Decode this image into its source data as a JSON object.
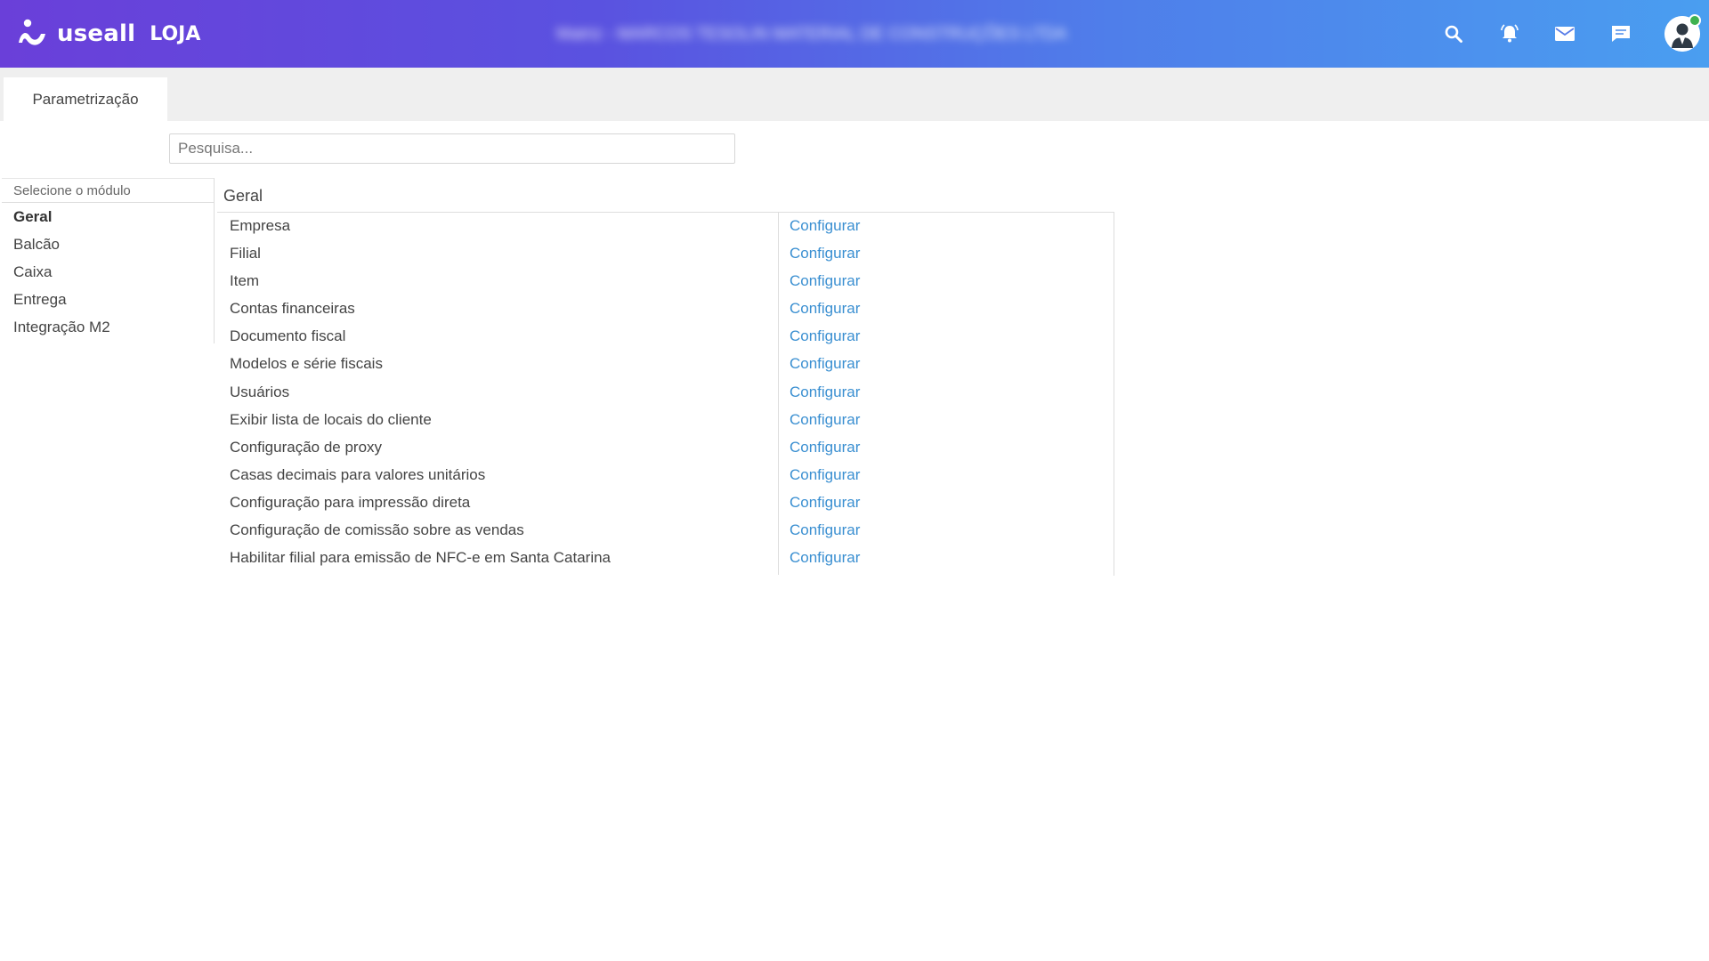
{
  "header": {
    "brand": "useall",
    "product": "LOJA",
    "company_text": "Matriz - MARCOS TESOLIN MATERIAL DE CONSTRUÇÕES LTDA",
    "icons": [
      "search-icon",
      "bell-icon",
      "mail-icon",
      "chat-icon",
      "user-avatar-icon"
    ],
    "status_color": "#3fb24f"
  },
  "tabs": [
    {
      "label": "Parametrização"
    }
  ],
  "search": {
    "placeholder": "Pesquisa...",
    "value": ""
  },
  "modules": {
    "header": "Selecione o módulo",
    "items": [
      {
        "label": "Geral",
        "active": true
      },
      {
        "label": "Balcão"
      },
      {
        "label": "Caixa"
      },
      {
        "label": "Entrega"
      },
      {
        "label": "Integração M2"
      }
    ]
  },
  "section": {
    "title": "Geral",
    "rows": [
      {
        "name": "Empresa",
        "action": "Configurar"
      },
      {
        "name": "Filial",
        "action": "Configurar"
      },
      {
        "name": "Item",
        "action": "Configurar"
      },
      {
        "name": "Contas financeiras",
        "action": "Configurar"
      },
      {
        "name": "Documento fiscal",
        "action": "Configurar"
      },
      {
        "name": "Modelos e série fiscais",
        "action": "Configurar"
      },
      {
        "name": "Usuários",
        "action": "Configurar"
      },
      {
        "name": "Exibir lista de locais do cliente",
        "action": "Configurar"
      },
      {
        "name": "Configuração de proxy",
        "action": "Configurar"
      },
      {
        "name": "Casas decimais para valores unitários",
        "action": "Configurar"
      },
      {
        "name": "Configuração para impressão direta",
        "action": "Configurar"
      },
      {
        "name": "Configuração de comissão sobre as vendas",
        "action": "Configurar"
      },
      {
        "name": "Habilitar filial para emissão de NFC-e em Santa Catarina",
        "action": "Configurar"
      }
    ]
  },
  "colors": {
    "link": "#3a8fd1",
    "gradient_start": "#6a3fd9",
    "gradient_end": "#4a9ef0"
  }
}
